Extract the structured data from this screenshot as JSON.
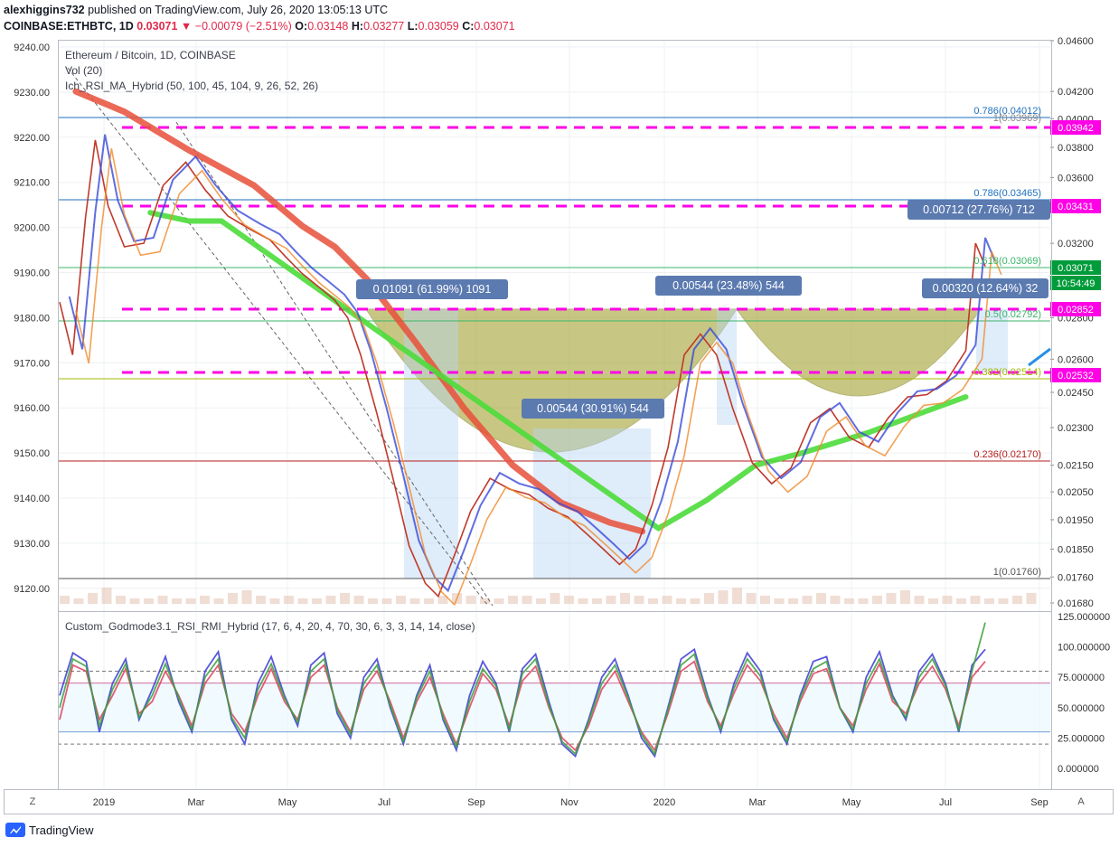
{
  "header": {
    "publisher": "alexhiggins732",
    "published_text": "published on TradingView.com, July 26, 2020 13:05:13 UTC",
    "symbol": "COINBASE:ETHBTC, 1D",
    "last": "0.03071",
    "change_arrow": "▼",
    "change": "−0.00079 (−2.51%)",
    "o_label": "O:",
    "o": "0.03148",
    "h_label": "H:",
    "h": "0.03277",
    "l_label": "L:",
    "l": "0.03059",
    "c_label": "C:",
    "c": "0.03071"
  },
  "legend": {
    "title": "Ethereum / Bitcoin, 1D, COINBASE",
    "vol": "Vol (20)",
    "ichimoku": "Ich_RSI_MA_Hybrid (50, 100, 45, 104, 9, 26, 52, 26)",
    "oscillator": "Custom_Godmode3.1_RSI_RMI_Hybrid (17, 6, 4, 20, 4, 70, 30, 6, 3, 3, 14, 14, close)"
  },
  "footer": {
    "brand": "TradingView",
    "z_button": "Z",
    "a_button": "A"
  },
  "colors": {
    "up": "#26a69a",
    "down": "#ef5350",
    "pink": "#ff00e6",
    "blue_label": "#5b7ab0",
    "ema_red": "#e8503a",
    "ema_green": "#4cdb3a",
    "cup": "#9a9a1f",
    "grid": "#eef0f3"
  },
  "chart_data": [
    {
      "type": "line",
      "title": "Ethereum / Bitcoin, 1D, COINBASE",
      "left_axis_ticks": [
        "9240.00",
        "9230.00",
        "9220.00",
        "9210.00",
        "9200.00",
        "9190.00",
        "9180.00",
        "9170.00",
        "9160.00",
        "9150.00",
        "9140.00",
        "9130.00",
        "9120.00"
      ],
      "right_axis_ticks": [
        "0.04600",
        "0.04200",
        "0.04000",
        "0.03800",
        "0.03600",
        "0.03200",
        "0.02800",
        "0.02600",
        "0.02450",
        "0.02300",
        "0.02150",
        "0.02050",
        "0.01950",
        "0.01850",
        "0.01760",
        "0.01680"
      ],
      "right_axis_labels": [
        {
          "text": "0.03942",
          "color": "#ff00e6"
        },
        {
          "text": "0.03431",
          "color": "#ff00e6"
        },
        {
          "text": "0.03071",
          "color": "#009b3a"
        },
        {
          "text": "10:54:49",
          "color": "#009b3a"
        },
        {
          "text": "0.02852",
          "color": "#ff00e6"
        },
        {
          "text": "0.02532",
          "color": "#ff00e6"
        }
      ],
      "x_axis_labels": [
        "2019",
        "Mar",
        "May",
        "Jul",
        "Sep",
        "Nov",
        "2020",
        "Mar",
        "May",
        "Jul",
        "Sep"
      ],
      "fib_labels": [
        "0.786(0.04012)",
        "1(0.03969)",
        "0.786(0.03465)",
        "0.618(0.03069)",
        "0.5(0.02792)",
        "0.382(0.02514)",
        "0.236(0.02170)",
        "1(0.01760)"
      ],
      "measure_labels": [
        "0.01091 (61.99%) 1091",
        "0.00544 (23.48%) 544",
        "0.00544 (30.91%) 544",
        "0.00712 (27.76%) 712",
        "0.00320 (12.64%) 32"
      ],
      "price_path": [
        [
          0,
          0.0288
        ],
        [
          8,
          0.0262
        ],
        [
          16,
          0.0335
        ],
        [
          22,
          0.0385
        ],
        [
          30,
          0.0342
        ],
        [
          40,
          0.0318
        ],
        [
          52,
          0.032
        ],
        [
          64,
          0.0355
        ],
        [
          78,
          0.037
        ],
        [
          90,
          0.0352
        ],
        [
          104,
          0.0336
        ],
        [
          118,
          0.0328
        ],
        [
          130,
          0.0322
        ],
        [
          140,
          0.0312
        ],
        [
          150,
          0.0303
        ],
        [
          160,
          0.0296
        ],
        [
          170,
          0.0289
        ],
        [
          178,
          0.028
        ],
        [
          186,
          0.0262
        ],
        [
          196,
          0.0236
        ],
        [
          206,
          0.021
        ],
        [
          216,
          0.0186
        ],
        [
          226,
          0.0174
        ],
        [
          234,
          0.017
        ],
        [
          244,
          0.0183
        ],
        [
          254,
          0.0198
        ],
        [
          266,
          0.021
        ],
        [
          278,
          0.0206
        ],
        [
          290,
          0.0204
        ],
        [
          302,
          0.0199
        ],
        [
          314,
          0.0196
        ],
        [
          326,
          0.019
        ],
        [
          336,
          0.0185
        ],
        [
          346,
          0.018
        ],
        [
          356,
          0.0185
        ],
        [
          366,
          0.02
        ],
        [
          376,
          0.0222
        ],
        [
          386,
          0.0262
        ],
        [
          396,
          0.0272
        ],
        [
          406,
          0.0262
        ],
        [
          416,
          0.0238
        ],
        [
          428,
          0.0216
        ],
        [
          440,
          0.0208
        ],
        [
          452,
          0.0214
        ],
        [
          464,
          0.0232
        ],
        [
          476,
          0.0238
        ],
        [
          488,
          0.0226
        ],
        [
          500,
          0.0222
        ],
        [
          512,
          0.0234
        ],
        [
          524,
          0.0243
        ],
        [
          536,
          0.0244
        ],
        [
          548,
          0.025
        ],
        [
          560,
          0.0264
        ],
        [
          566,
          0.032
        ],
        [
          572,
          0.0307
        ]
      ],
      "ema_red_path": [
        [
          10,
          0.042
        ],
        [
          40,
          0.0405
        ],
        [
          80,
          0.0378
        ],
        [
          120,
          0.0355
        ],
        [
          150,
          0.033
        ],
        [
          170,
          0.0318
        ],
        [
          190,
          0.03
        ],
        [
          220,
          0.0268
        ],
        [
          250,
          0.0238
        ],
        [
          280,
          0.0215
        ],
        [
          310,
          0.0201
        ],
        [
          340,
          0.0194
        ],
        [
          360,
          0.0191
        ]
      ],
      "ema_green_path": [
        [
          56,
          0.0338
        ],
        [
          80,
          0.0333
        ],
        [
          100,
          0.0333
        ],
        [
          370,
          0.0192
        ],
        [
          400,
          0.0202
        ],
        [
          430,
          0.0215
        ],
        [
          460,
          0.022
        ],
        [
          500,
          0.0228
        ],
        [
          540,
          0.0238
        ],
        [
          560,
          0.0243
        ]
      ],
      "volume": [
        3,
        2,
        4,
        6,
        3,
        2,
        2,
        3,
        2,
        2,
        3,
        2,
        4,
        5,
        3,
        2,
        3,
        2,
        2,
        3,
        4,
        3,
        2,
        2,
        3,
        2,
        2,
        3,
        4,
        3,
        2,
        2,
        3,
        3,
        2,
        4,
        3,
        2,
        2,
        3,
        4,
        3,
        2,
        3,
        2,
        2,
        4,
        5,
        6,
        4,
        3,
        2,
        2,
        3,
        4,
        3,
        2,
        2,
        3,
        4,
        5,
        3,
        2,
        3,
        2,
        3,
        2,
        2,
        3,
        4
      ]
    },
    {
      "type": "line",
      "title": "Custom_Godmode3.1_RSI_RMI_Hybrid (17, 6, 4, 20, 4, 70, 30, 6, 3, 3, 14, 14, close)",
      "y_axis_ticks": [
        "125.000000",
        "100.000000",
        "75.000000",
        "50.000000",
        "25.000000",
        "0.000000"
      ],
      "ylim": [
        0,
        125
      ],
      "levels": [
        80,
        70,
        30,
        20
      ],
      "series": [
        {
          "color": "#3b3bd6",
          "values": [
            60,
            95,
            88,
            30,
            70,
            90,
            40,
            65,
            92,
            55,
            30,
            80,
            96,
            40,
            20,
            70,
            92,
            60,
            35,
            85,
            95,
            45,
            25,
            75,
            90,
            50,
            20,
            60,
            85,
            40,
            15,
            60,
            88,
            70,
            30,
            82,
            94,
            55,
            20,
            10,
            40,
            75,
            90,
            60,
            25,
            10,
            50,
            90,
            98,
            60,
            30,
            70,
            95,
            80,
            40,
            20,
            60,
            88,
            92,
            50,
            30,
            75,
            96,
            60,
            40,
            80,
            94,
            70,
            30,
            85,
            98
          ]
        },
        {
          "color": "#e04060",
          "values": [
            40,
            85,
            80,
            40,
            60,
            82,
            45,
            55,
            80,
            60,
            35,
            70,
            85,
            45,
            30,
            60,
            82,
            55,
            40,
            75,
            85,
            50,
            30,
            65,
            80,
            55,
            25,
            55,
            75,
            45,
            20,
            50,
            78,
            65,
            35,
            72,
            84,
            50,
            25,
            15,
            35,
            65,
            80,
            55,
            30,
            15,
            45,
            80,
            88,
            55,
            35,
            62,
            85,
            72,
            45,
            25,
            55,
            78,
            82,
            50,
            35,
            65,
            86,
            55,
            45,
            70,
            84,
            65,
            35,
            75,
            88
          ]
        },
        {
          "color": "#3aa03a",
          "values": [
            50,
            90,
            84,
            35,
            65,
            86,
            42,
            60,
            86,
            58,
            32,
            75,
            90,
            42,
            25,
            65,
            86,
            58,
            38,
            80,
            90,
            48,
            28,
            70,
            85,
            52,
            22,
            58,
            80,
            42,
            18,
            55,
            82,
            68,
            32,
            78,
            90,
            52,
            22,
            12,
            38,
            70,
            85,
            58,
            28,
            12,
            48,
            85,
            94,
            58,
            32,
            66,
            90,
            76,
            42,
            22,
            58,
            82,
            88,
            50,
            32,
            70,
            90,
            58,
            42,
            75,
            90,
            68,
            32,
            80,
            120
          ]
        }
      ]
    }
  ]
}
